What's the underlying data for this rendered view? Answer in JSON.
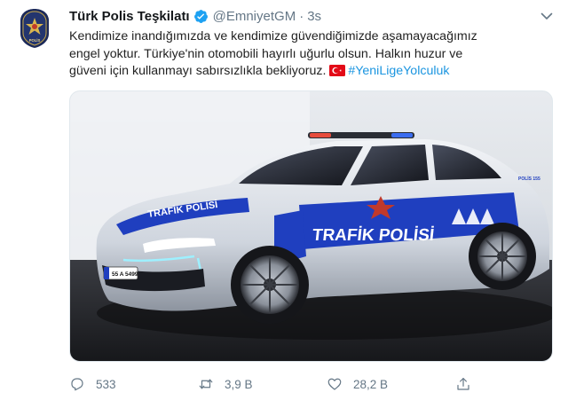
{
  "tweet": {
    "display_name": "Türk Polis Teşkilatı",
    "handle": "@EmniyetGM",
    "separator": "·",
    "time": "3s",
    "text_lines": [
      "Kendimize inandığımızda ve kendimize güvendiğimizde aşamayacağımız",
      "engel yoktur. Türkiye'nin otomobili hayırlı uğurlu olsun. Halkın huzur ve",
      "güveni için kullanmayı sabırsızlıkla bekliyoruz."
    ],
    "hashtag": "#YeniLigeYolculuk",
    "verified": true,
    "flag_icon": "turkey-flag-icon",
    "media": {
      "car_side_text": "TRAFİK POLİSİ",
      "car_hood_text": "TRAFİK POLİSİ",
      "plate": "55 A 5499",
      "door_small_text": "POLİS 155"
    },
    "actions": {
      "reply_count": "533",
      "retweet_count": "3,9 B",
      "like_count": "28,2 B"
    }
  },
  "colors": {
    "link": "#1b95e0",
    "secondary_text": "#657786",
    "police_blue": "#1f3fbf",
    "car_silver": "#d7dce4"
  }
}
